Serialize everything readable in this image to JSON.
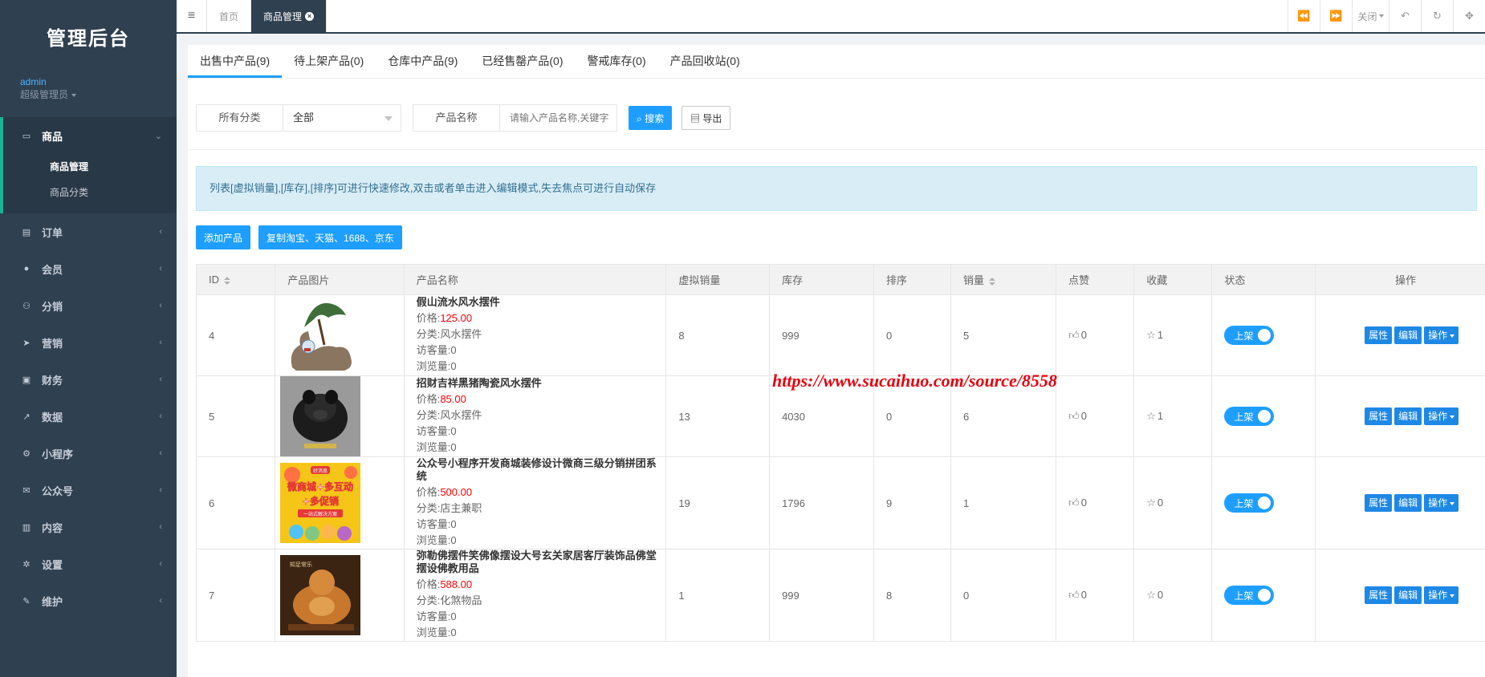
{
  "app": {
    "title": "管理后台"
  },
  "user": {
    "name": "admin",
    "role": "超级管理员"
  },
  "sidebar": {
    "groups": [
      {
        "label": "商品",
        "icon": "laptop-icon",
        "glyph": "▭",
        "expanded": true,
        "subs": [
          "商品管理",
          "商品分类"
        ]
      },
      {
        "label": "订单",
        "icon": "order-icon",
        "glyph": "▤"
      },
      {
        "label": "会员",
        "icon": "user-icon",
        "glyph": "●"
      },
      {
        "label": "分销",
        "icon": "users-icon",
        "glyph": "⚇"
      },
      {
        "label": "营销",
        "icon": "send-icon",
        "glyph": "➤"
      },
      {
        "label": "财务",
        "icon": "money-icon",
        "glyph": "▣"
      },
      {
        "label": "数据",
        "icon": "chart-icon",
        "glyph": "↗"
      },
      {
        "label": "小程序",
        "icon": "miniapp-icon",
        "glyph": "⚙"
      },
      {
        "label": "公众号",
        "icon": "wechat-icon",
        "glyph": "✉"
      },
      {
        "label": "内容",
        "icon": "book-icon",
        "glyph": "▥"
      },
      {
        "label": "设置",
        "icon": "gear-icon",
        "glyph": "✲"
      },
      {
        "label": "维护",
        "icon": "wrench-icon",
        "glyph": "✎"
      }
    ]
  },
  "tabbar": {
    "tabs": [
      {
        "label": "首页"
      },
      {
        "label": "商品管理"
      }
    ],
    "close_label": "关闭"
  },
  "subtabs": [
    "出售中产品(9)",
    "待上架产品(0)",
    "仓库中产品(9)",
    "已经售罄产品(0)",
    "警戒库存(0)",
    "产品回收站(0)"
  ],
  "filters": {
    "category_label": "所有分类",
    "category_value": "全部",
    "name_label": "产品名称",
    "name_placeholder": "请输入产品名称,关键字",
    "search_label": "搜索",
    "export_label": "导出"
  },
  "alert": "列表[虚拟销量],[库存],[排序]可进行快速修改,双击或者单击进入编辑模式,失去焦点可进行自动保存",
  "actions": {
    "add_label": "添加产品",
    "copy_label": "复制淘宝、天猫、1688、京东"
  },
  "table": {
    "headers": [
      "ID",
      "产品图片",
      "产品名称",
      "虚拟销量",
      "库存",
      "排序",
      "销量",
      "点赞",
      "收藏",
      "状态",
      "操作"
    ],
    "price_prefix": "价格:",
    "rows": [
      {
        "id": "4",
        "name": "假山流水风水摆件",
        "price": "125.00",
        "category": "分类:风水摆件",
        "visits": "访客量:0",
        "views": "浏览量:0",
        "ficti": "8",
        "stock": "999",
        "sort": "0",
        "sales": "5",
        "likes": "0",
        "collects": "1",
        "status": "上架",
        "thumb": "thumb-rockery"
      },
      {
        "id": "5",
        "name": "招财吉祥黑猪陶瓷风水摆件",
        "price": "85.00",
        "category": "分类:风水摆件",
        "visits": "访客量:0",
        "views": "浏览量:0",
        "ficti": "13",
        "stock": "4030",
        "sort": "0",
        "sales": "6",
        "likes": "0",
        "collects": "1",
        "status": "上架",
        "thumb": "thumb-pig"
      },
      {
        "id": "6",
        "name": "公众号小程序开发商城装修设计微商三级分销拼团系统",
        "price": "500.00",
        "category": "分类:店主兼职",
        "visits": "访客量:0",
        "views": "浏览量:0",
        "ficti": "19",
        "stock": "1796",
        "sort": "9",
        "sales": "1",
        "likes": "0",
        "collects": "0",
        "status": "上架",
        "thumb": "thumb-poster"
      },
      {
        "id": "7",
        "name": "弥勒佛摆件笑佛像摆设大号玄关家居客厅装饰品佛堂摆设佛教用品",
        "price": "588.00",
        "category": "分类:化煞物品",
        "visits": "访客量:0",
        "views": "浏览量:0",
        "ficti": "1",
        "stock": "999",
        "sort": "8",
        "sales": "0",
        "likes": "0",
        "collects": "0",
        "status": "上架",
        "thumb": "thumb-buddha"
      }
    ],
    "op_labels": [
      "属性",
      "编辑",
      "操作"
    ]
  },
  "poster_text": {
    "top": "好消息",
    "line1": "微商城+多互动",
    "line2": "+多促销",
    "line3": "一站式解决方案"
  },
  "buddha_text": "知足常乐",
  "watermark": "https://www.sucaihuo.com/source/8558",
  "colors": {
    "sidebar": "#2f4050",
    "accent": "#1e9fff",
    "price": "#ff0000"
  }
}
